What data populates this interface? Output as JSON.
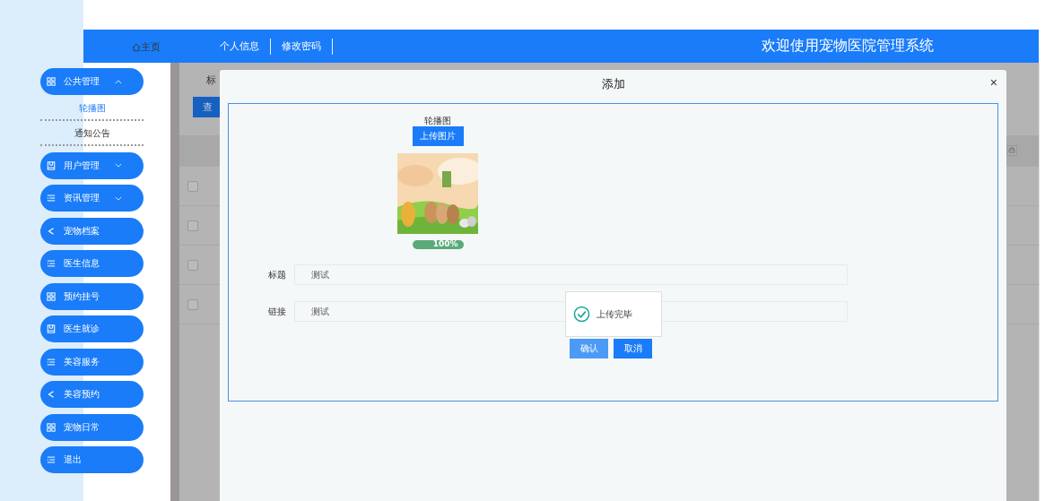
{
  "header": {
    "home": "主页",
    "links": [
      "个人信息",
      "修改密码"
    ],
    "title": "欢迎使用宠物医院管理系统"
  },
  "sidebar": [
    {
      "label": "公共管理",
      "kind": "grid",
      "expanded": true,
      "children": [
        {
          "label": "轮播图",
          "selected": true
        },
        {
          "label": "通知公告",
          "selected": false
        }
      ]
    },
    {
      "label": "用户管理",
      "kind": "book",
      "expanded": false
    },
    {
      "label": "资讯管理",
      "kind": "list",
      "expanded": false
    },
    {
      "label": "宠物档案",
      "kind": "share"
    },
    {
      "label": "医生信息",
      "kind": "list"
    },
    {
      "label": "预约挂号",
      "kind": "grid"
    },
    {
      "label": "医生就诊",
      "kind": "book"
    },
    {
      "label": "美容服务",
      "kind": "list"
    },
    {
      "label": "美容预约",
      "kind": "share"
    },
    {
      "label": "宠物日常",
      "kind": "grid"
    },
    {
      "label": "退出",
      "kind": "list"
    }
  ],
  "background": {
    "search_label": "标",
    "search_button": "查",
    "rows": [
      {
        "checked": false
      },
      {
        "checked": false
      },
      {
        "checked": false
      },
      {
        "checked": false
      }
    ]
  },
  "dialog": {
    "title": "添加",
    "close": "×",
    "upload_label": "轮播图",
    "upload_button": "上传图片",
    "progress": {
      "level": 1,
      "reading": "100%"
    },
    "fields": [
      {
        "label": "标题",
        "value": "测试"
      },
      {
        "label": "链接",
        "value": "测试"
      }
    ],
    "toast": "上传完毕",
    "buttons": [
      {
        "label": "确认",
        "kind": "hover"
      },
      {
        "label": "取消",
        "kind": "primary"
      }
    ]
  }
}
